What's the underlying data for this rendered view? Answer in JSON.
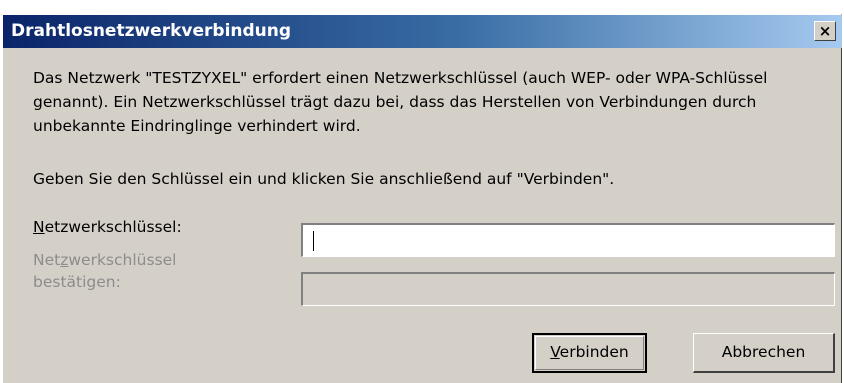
{
  "window": {
    "title": "Drahtlosnetzwerkverbindung",
    "close_glyph": "×"
  },
  "message": {
    "paragraph1": "Das Netzwerk \"TESTZYXEL\" erfordert einen Netzwerkschlüssel (auch WEP- oder WPA-Schlüssel genannt). Ein Netzwerkschlüssel trägt dazu bei, dass das Herstellen von Verbindungen durch unbekannte Eindringlinge verhindert wird.",
    "paragraph2": "Geben Sie den Schlüssel ein und klicken Sie anschließend auf \"Verbinden\"."
  },
  "fields": {
    "key_label_mnemonic": "N",
    "key_label_rest": "etzwerkschlüssel:",
    "key_value": "",
    "confirm_label_pre": "Net",
    "confirm_label_mnemonic": "z",
    "confirm_label_post": "werkschlüssel bestätigen:",
    "confirm_value": ""
  },
  "buttons": {
    "connect_mnemonic": "V",
    "connect_rest": "erbinden",
    "cancel": "Abbrechen"
  },
  "colors": {
    "title_gradient_start": "#0a246a",
    "title_gradient_end": "#a6caf0",
    "dialog_bg": "#d4d0c8",
    "disabled_text": "#8c8c8c"
  }
}
